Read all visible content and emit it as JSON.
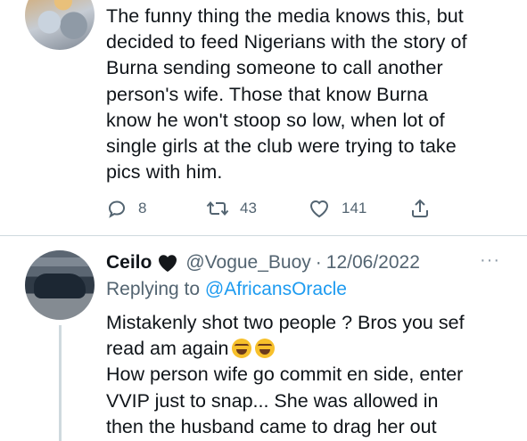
{
  "tweet1": {
    "text": "The funny thing the media knows this, but\ndecided to feed Nigerians with the story of\nBurna sending someone to call another\nperson's wife. Those that know Burna\nknow he won't stoop so low, when lot of\nsingle girls at the club were trying to take\npics with him.",
    "actions": {
      "reply_count": "8",
      "retweet_count": "43",
      "like_count": "141"
    }
  },
  "tweet2": {
    "name": "Ceilo",
    "handle": "@Vogue_Buoy",
    "separator": "·",
    "date": "12/06/2022",
    "more": "···",
    "replying_prefix": "Replying to ",
    "replying_handle": "@AfricansOracle",
    "text_line1": "Mistakenly shot two people ? Bros you sef",
    "text_line2": "read am again",
    "text_rest": "How person wife go commit en side, enter\nVVIP just to snap... She was allowed in\nthen the husband came to drag her out"
  },
  "icons": {
    "reply": "reply-icon",
    "retweet": "retweet-icon",
    "like": "heart-icon",
    "share": "share-icon",
    "name_emoji": "black-heart-icon",
    "laugh": "tears-of-joy-emoji"
  },
  "colors": {
    "link": "#1d9bf0",
    "secondary_text": "#536471",
    "divider": "#cfd9de"
  }
}
